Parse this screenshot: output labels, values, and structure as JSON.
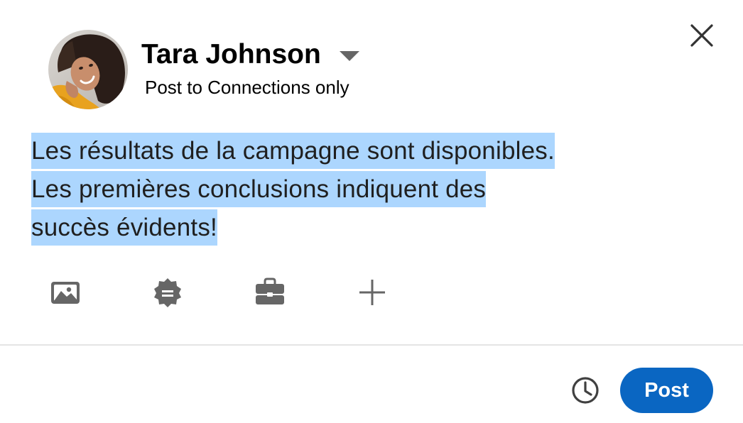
{
  "author": {
    "name": "Tara Johnson",
    "visibility": "Post to Connections only"
  },
  "editor": {
    "lines": [
      "Les résultats de la campagne sont disponibles.",
      "Les premières conclusions indiquent des",
      "succès évidents! "
    ]
  },
  "toolbar": {
    "icons": [
      "image-icon",
      "badge-icon",
      "briefcase-icon",
      "plus-icon"
    ]
  },
  "footer": {
    "post_label": "Post",
    "schedule_icon": "clock-icon"
  },
  "colors": {
    "accent": "#0a66c2",
    "selection": "#acd6fe",
    "icon": "#666666"
  }
}
